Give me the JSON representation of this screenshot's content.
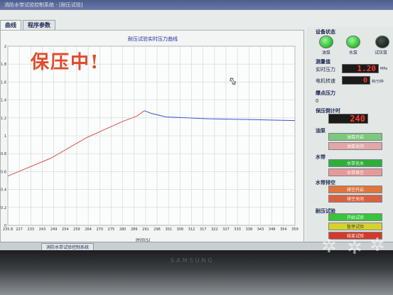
{
  "window": {
    "title": "消防水带试验控制系统 - [耐压试验]"
  },
  "tabs": [
    {
      "label": "曲线"
    },
    {
      "label": "程序参数"
    }
  ],
  "chart_data": {
    "type": "line",
    "title": "耐压试验实时压力曲线",
    "xlabel": "时间(S)",
    "ylabel": "",
    "x_ticks": [
      "235.8",
      "227",
      "233",
      "243",
      "249",
      "254",
      "259",
      "264",
      "270",
      "275",
      "280",
      "286",
      "291",
      "296",
      "301",
      "306",
      "312",
      "317",
      "322",
      "327",
      "333",
      "338",
      "343",
      "348",
      "354",
      "359"
    ],
    "y_ticks": [
      "2",
      "1.8",
      "1.6",
      "1.4",
      "1.2",
      "1",
      "0.8",
      "0.6",
      "0.4",
      "0.2",
      "0"
    ],
    "ylim": [
      0,
      2
    ],
    "series": [
      {
        "color": "#e05050",
        "points": [
          [
            0,
            0.55
          ],
          [
            0.3,
            0.75
          ],
          [
            0.55,
            0.98
          ],
          [
            0.8,
            1.16
          ],
          [
            0.9,
            1.22
          ],
          [
            0.95,
            1.28
          ]
        ]
      },
      {
        "color": "#3a55d0",
        "points": [
          [
            0.95,
            1.28
          ],
          [
            1.0,
            1.25
          ],
          [
            1.1,
            1.21
          ],
          [
            1.4,
            1.19
          ],
          [
            1.7,
            1.18
          ],
          [
            2.0,
            1.17
          ]
        ]
      }
    ]
  },
  "overlay": {
    "text": "保压中!"
  },
  "status": {
    "title": "设备状态",
    "leds": [
      {
        "label": "油泵",
        "on": true
      },
      {
        "label": "水泵",
        "on": true
      },
      {
        "label": "试压泵",
        "on": false
      }
    ]
  },
  "measure": {
    "title": "测量值",
    "pressure_label": "实时压力",
    "pressure_value": "1.20",
    "pressure_unit": "MPa",
    "speed_label": "电机转速",
    "speed_value": "0",
    "speed_unit": "转/分钟"
  },
  "burst": {
    "title": "爆点压力",
    "value": "0"
  },
  "timer": {
    "title": "保压倒计时",
    "value": "240"
  },
  "pump": {
    "title": "油泵",
    "start": "油泵开启",
    "stop": "油泵关闭"
  },
  "water": {
    "title": "水带",
    "start": "水带充水",
    "stop": "水带排空"
  },
  "drain": {
    "title": "水带排空",
    "start": "排空开启",
    "stop": "排空关闭"
  },
  "test": {
    "title": "耐压试验",
    "start": "开始试验",
    "pause": "暂停试验",
    "stop": "结束试验"
  },
  "taskbar": {
    "item": "消防水带试验控制系统"
  },
  "monitor": {
    "brand": "SAMSUNG"
  }
}
